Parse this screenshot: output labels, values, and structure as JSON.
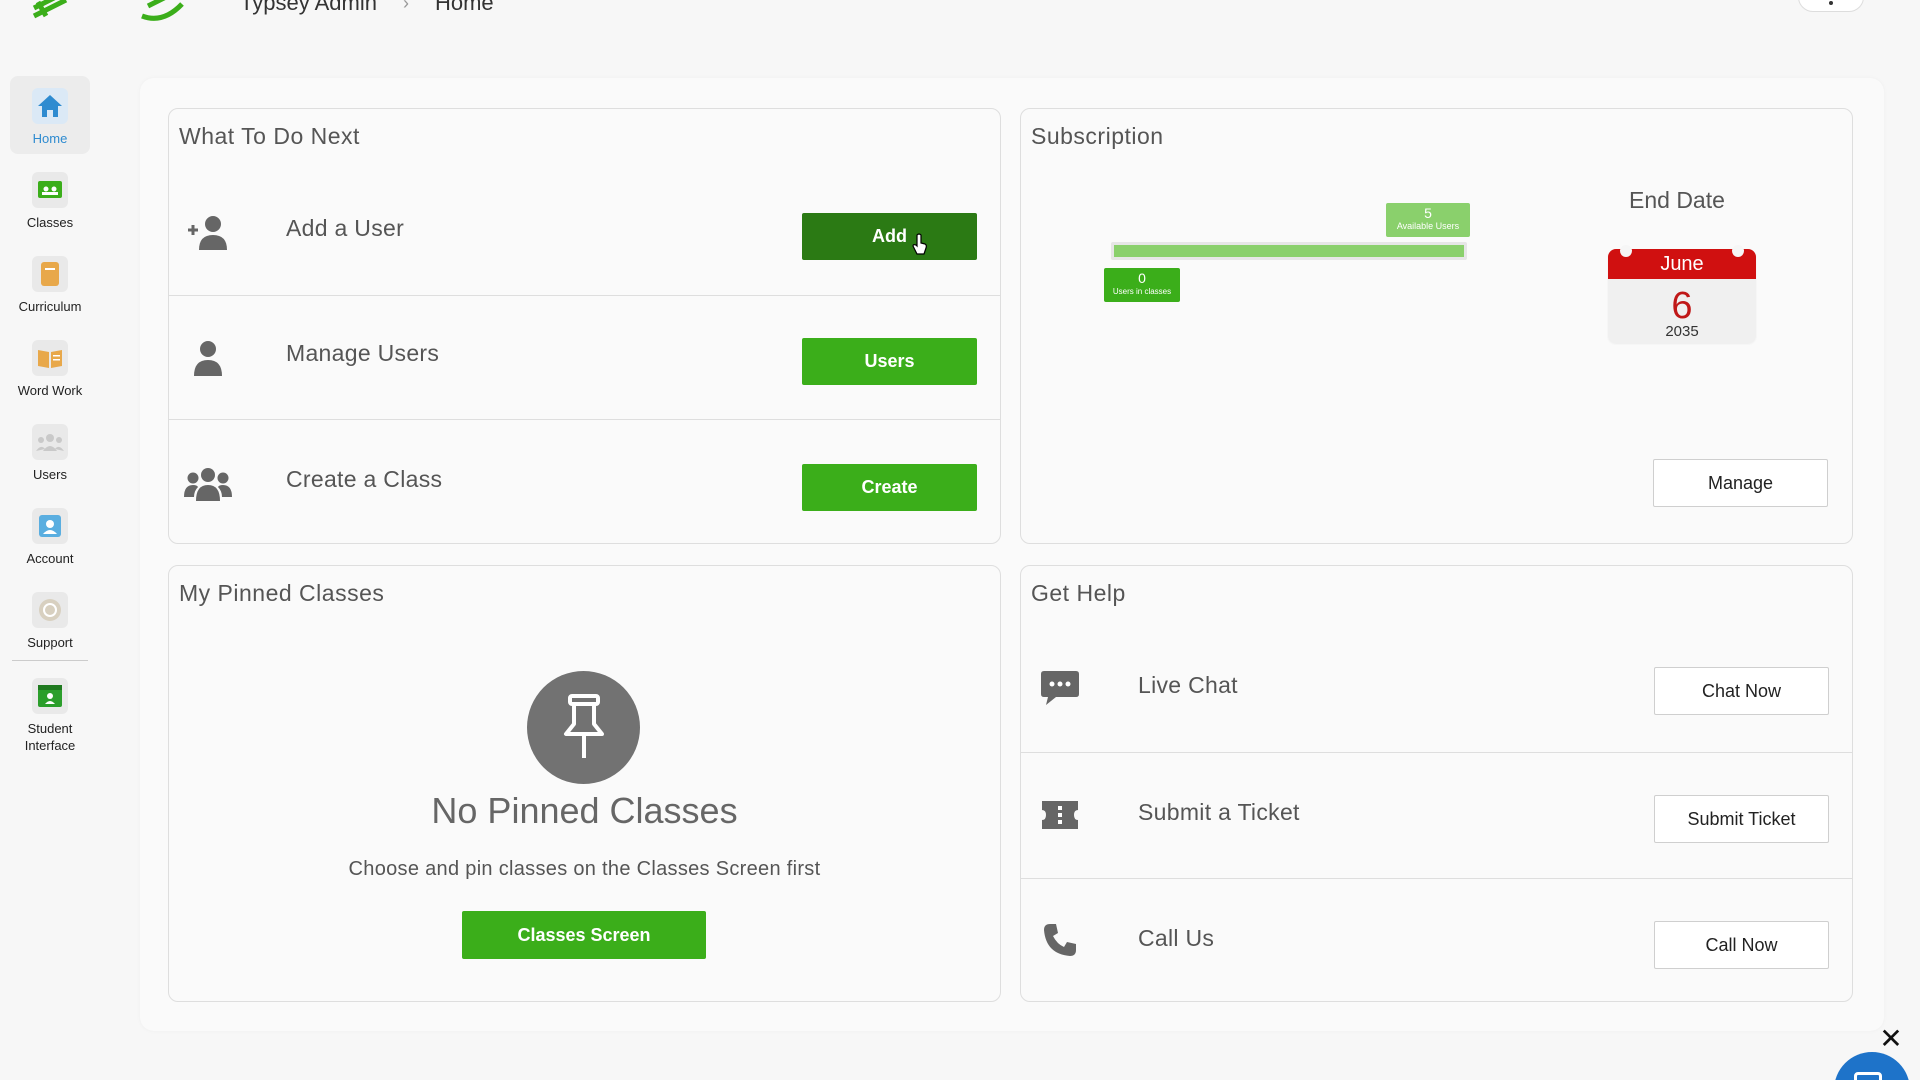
{
  "header": {
    "breadcrumb": [
      "Typsey Admin",
      "Home"
    ],
    "separator": "›"
  },
  "sidebar": {
    "items": [
      {
        "label": "Home",
        "icon": "home-icon",
        "active": true
      },
      {
        "label": "Classes",
        "icon": "classes-icon"
      },
      {
        "label": "Curriculum",
        "icon": "curriculum-icon"
      },
      {
        "label": "Word Work",
        "icon": "word-work-icon"
      },
      {
        "label": "Users",
        "icon": "users-icon"
      },
      {
        "label": "Account",
        "icon": "account-icon"
      },
      {
        "label": "Support",
        "icon": "support-icon"
      },
      {
        "label": "Student Interface",
        "icon": "student-interface-icon"
      }
    ]
  },
  "todo": {
    "title": "What To Do Next",
    "rows": [
      {
        "label": "Add a User",
        "button": "Add"
      },
      {
        "label": "Manage Users",
        "button": "Users"
      },
      {
        "label": "Create a Class",
        "button": "Create"
      }
    ]
  },
  "subscription": {
    "title": "Subscription",
    "available_users": {
      "value": "5",
      "label": "Available Users"
    },
    "users_in_classes": {
      "value": "0",
      "label": "Users in classes"
    },
    "end_date_label": "End Date",
    "end_date": {
      "month": "June",
      "day": "6",
      "year": "2035"
    },
    "manage_button": "Manage"
  },
  "pinned": {
    "title": "My Pinned Classes",
    "empty_title": "No Pinned Classes",
    "empty_desc": "Choose and pin classes on the Classes Screen first",
    "button": "Classes Screen"
  },
  "help": {
    "title": "Get Help",
    "rows": [
      {
        "label": "Live Chat",
        "button": "Chat Now"
      },
      {
        "label": "Submit a Ticket",
        "button": "Submit Ticket"
      },
      {
        "label": "Call Us",
        "button": "Call Now"
      }
    ]
  },
  "colors": {
    "accent_green": "#3bae1a",
    "dark_green": "#2b7a14",
    "light_green": "#8ad06c",
    "calendar_red": "#d01010",
    "active_blue": "#2e8bd0"
  }
}
